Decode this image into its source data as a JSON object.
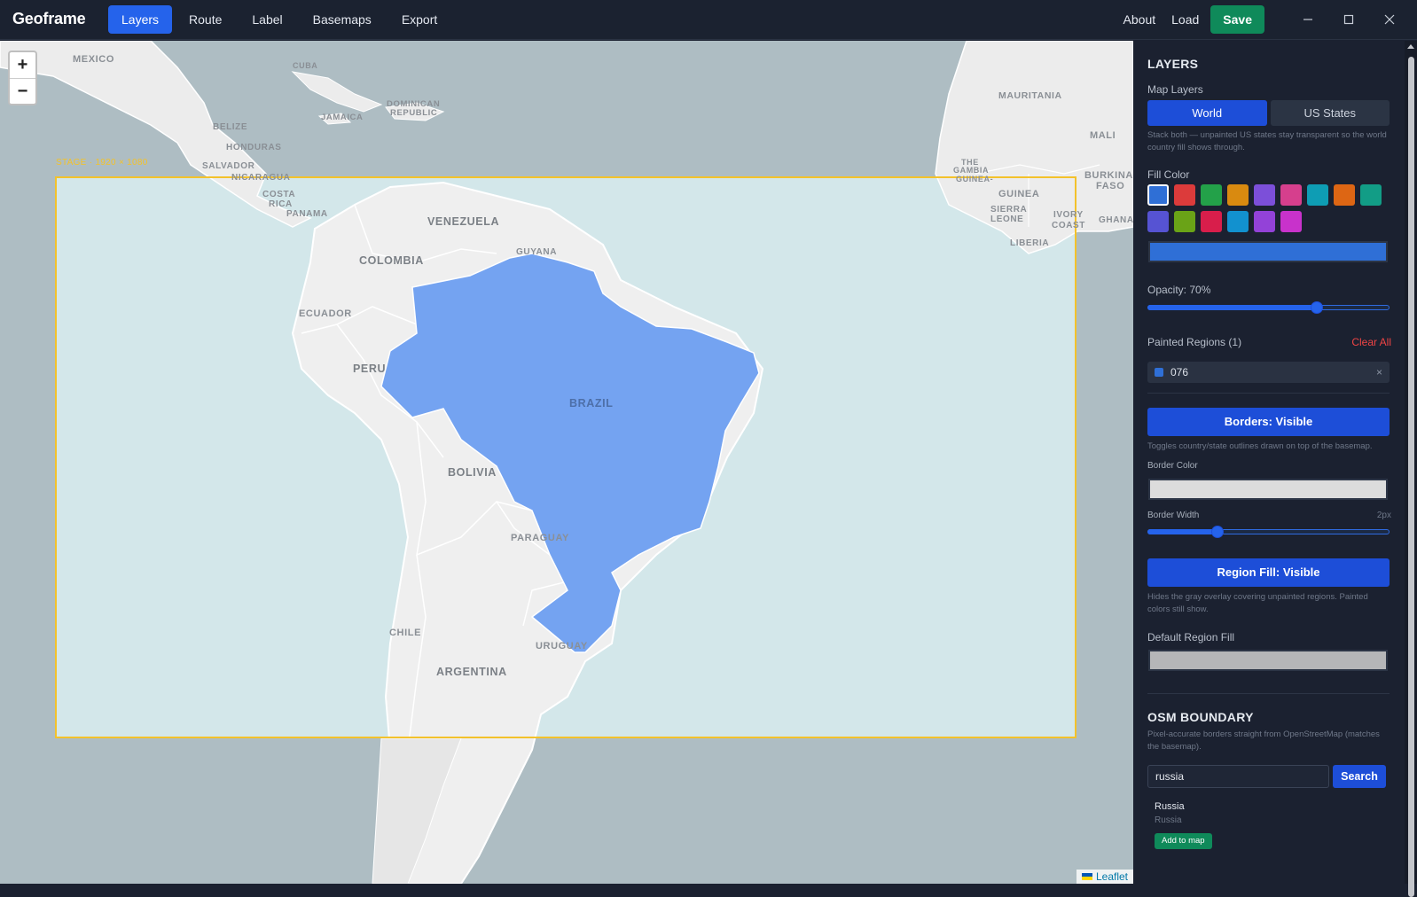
{
  "app": {
    "title": "Geoframe"
  },
  "nav": {
    "items": [
      "Layers",
      "Route",
      "Label",
      "Basemaps",
      "Export"
    ],
    "active": "Layers"
  },
  "header_right": {
    "about": "About",
    "load": "Load",
    "save": "Save"
  },
  "window_controls": [
    "minimize-icon",
    "maximize-icon",
    "close-icon"
  ],
  "map": {
    "zoom_in": "+",
    "zoom_out": "−",
    "stage_label": "STAGE · 1920 × 1080",
    "attribution": "Leaflet",
    "labels": {
      "mexico": "MEXICO",
      "cuba": "CUBA",
      "dominican": "DOMINICAN",
      "republic": "REPUBLIC",
      "jamaica": "JAMAICA",
      "belize": "BELIZE",
      "honduras": "HONDURAS",
      "salvador": "SALVADOR",
      "nicaragua": "NICARAGUA",
      "costa": "COSTA",
      "rica": "RICA",
      "panama": "PANAMA",
      "venezuela": "VENEZUELA",
      "guyana": "GUYANA",
      "colombia": "COLOMBIA",
      "ecuador": "ECUADOR",
      "peru": "PERU",
      "brazil": "BRAZIL",
      "bolivia": "BOLIVIA",
      "paraguay": "PARAGUAY",
      "chile": "CHILE",
      "uruguay": "URUGUAY",
      "argentina": "ARGENTINA",
      "mauritania": "MAURITANIA",
      "mali": "MALI",
      "burkina": "BURKINA",
      "faso": "FASO",
      "the": "THE",
      "gambia": "GAMBIA",
      "guinea_bissau": "GUINEA-",
      "guinea": "GUINEA",
      "sierra": "SIERRA",
      "leone": "LEONE",
      "ivory": "IVORY",
      "coast": "COAST",
      "ghana": "GHANA",
      "liberia": "LIBERIA"
    }
  },
  "sidebar": {
    "layers_title": "LAYERS",
    "map_layers_label": "Map Layers",
    "layer_options": [
      "World",
      "US States"
    ],
    "layer_selected": "World",
    "layer_hint": "Stack both — unpainted US states stay transparent so the world country fill shows through.",
    "fill_color_label": "Fill Color",
    "fill_colors": [
      "#2f6fd6",
      "#dc3b3b",
      "#23a149",
      "#d98a10",
      "#7c4fd9",
      "#d63f8d",
      "#0e9db4",
      "#dd6614",
      "#129d86",
      "#5653d3",
      "#6aa317",
      "#d81e4b",
      "#1291cf",
      "#9342d8",
      "#c832cb"
    ],
    "selected_fill": "#2f6fd6",
    "opacity_label": "Opacity: 70%",
    "opacity": 0.7,
    "painted_label": "Painted Regions (1)",
    "clear_all": "Clear All",
    "painted_regions": [
      {
        "id": "076",
        "color": "#2f6fd6"
      }
    ],
    "remove_icon": "×",
    "borders_button": "Borders: Visible",
    "borders_hint": "Toggles country/state outlines drawn on top of the basemap.",
    "border_color_label": "Border Color",
    "border_color": "#dcdcdc",
    "border_width_label": "Border Width",
    "border_width_value": "2px",
    "border_width_fraction": 0.29,
    "region_fill_button": "Region Fill: Visible",
    "region_fill_hint": "Hides the gray overlay covering unpainted regions. Painted colors still show.",
    "default_fill_label": "Default Region Fill",
    "default_fill_color": "#b5b6b8",
    "osm_title": "OSM BOUNDARY",
    "osm_hint": "Pixel-accurate borders straight from OpenStreetMap (matches the basemap).",
    "search_value": "russia",
    "search_button": "Search",
    "result_name": "Russia",
    "result_sub": "Russia",
    "add_button": "Add to map"
  }
}
